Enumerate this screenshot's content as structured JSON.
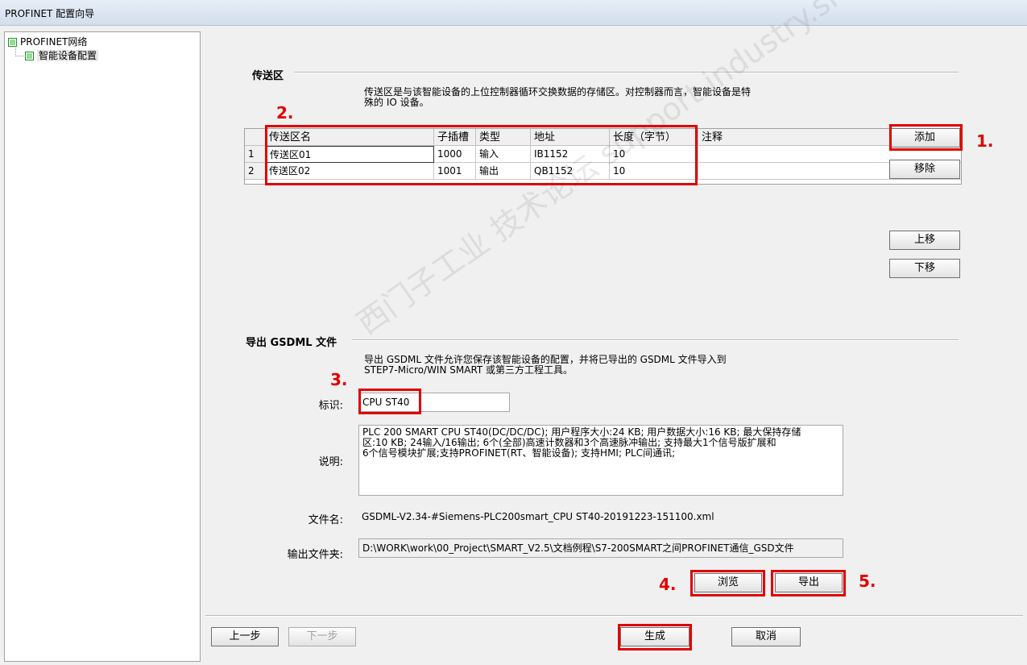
{
  "window": {
    "title": "PROFINET 配置向导"
  },
  "tree": {
    "root": "PROFINET网络",
    "child": "智能设备配置"
  },
  "transfer": {
    "title": "传送区",
    "description_line1": "传送区是与该智能设备的上位控制器循环交换数据的存储区。对控制器而言，智能设备是特",
    "description_line2": "殊的 IO 设备。",
    "columns": [
      "传送区名",
      "子插槽",
      "类型",
      "地址",
      "长度（字节）",
      "注释"
    ],
    "rows": [
      {
        "num": "1",
        "name": "传送区01",
        "slot": "1000",
        "type": "输入",
        "addr": "IB1152",
        "len": "10",
        "note": ""
      },
      {
        "num": "2",
        "name": "传送区02",
        "slot": "1001",
        "type": "输出",
        "addr": "QB1152",
        "len": "10",
        "note": ""
      }
    ],
    "buttons": {
      "add": "添加",
      "remove": "移除",
      "up": "上移",
      "down": "下移"
    }
  },
  "gsdml": {
    "title": "导出 GSDML 文件",
    "description_line1": "导出 GSDML 文件允许您保存该智能设备的配置，并将已导出的 GSDML 文件导入到",
    "description_line2": "STEP7-Micro/WIN SMART 或第三方工程工具。",
    "id_label": "标识:",
    "id_value": "CPU ST40",
    "desc_label": "说明:",
    "desc_line1": "PLC 200 SMART CPU ST40(DC/DC/DC); 用户程序大小:24 KB; 用户数据大小:16 KB; 最大保持存储",
    "desc_line2": "区:10 KB; 24输入/16输出; 6个(全部)高速计数器和3个高速脉冲输出; 支持最大1个信号版扩展和",
    "desc_line3": "6个信号模块扩展;支持PROFINET(RT、智能设备); 支持HMI; PLC间通讯;",
    "filename_label": "文件名:",
    "filename_value": "GSDML-V2.34-#Siemens-PLC200smart_CPU ST40-20191223-151100.xml",
    "folder_label": "输出文件夹:",
    "folder_value": "D:\\WORK\\work\\00_Project\\SMART_V2.5\\文档例程\\S7-200SMART之间PROFINET通信_GSD文件",
    "browse": "浏览",
    "export": "导出"
  },
  "footer": {
    "prev": "上一步",
    "next": "下一步",
    "generate": "生成",
    "cancel": "取消"
  },
  "annotations": {
    "s1": "1.",
    "s2": "2.",
    "s3": "3.",
    "s4": "4.",
    "s5": "5."
  },
  "watermark": "西门子工业 技术论坛 support.industry.siemens.com/cs",
  "colors": {
    "highlight": "#e10000"
  }
}
